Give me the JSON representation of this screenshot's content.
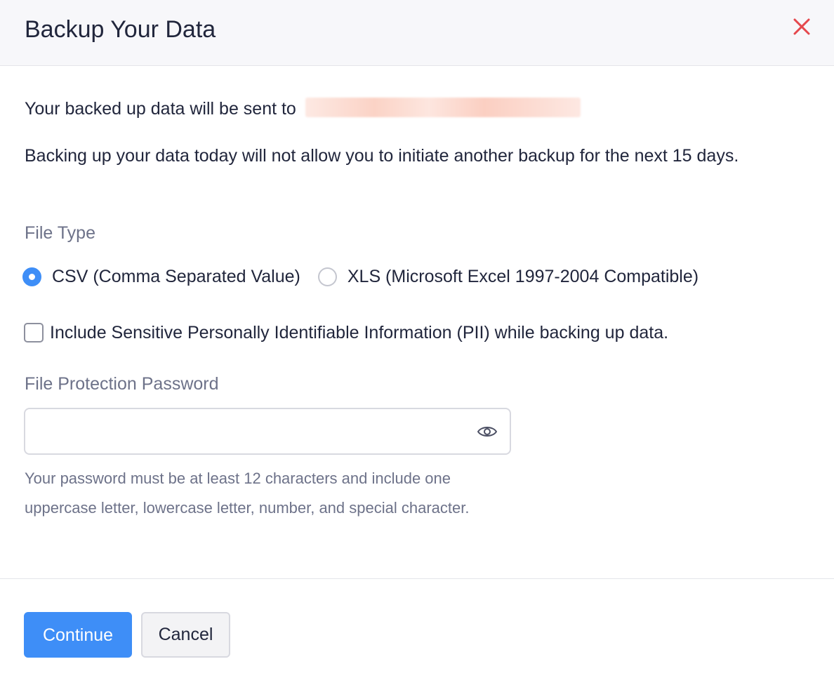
{
  "dialog": {
    "title": "Backup Your Data",
    "close_icon": "close-icon"
  },
  "body": {
    "sent_to_text": "Your backed up data will be sent to",
    "warning_text": "Backing up your data today will not allow you to initiate another backup for the next 15 days.",
    "file_type_label": "File Type",
    "file_types": [
      {
        "label": "CSV (Comma Separated Value)",
        "selected": true
      },
      {
        "label": "XLS (Microsoft Excel 1997-2004 Compatible)",
        "selected": false
      }
    ],
    "pii_checkbox_label": "Include Sensitive Personally Identifiable Information (PII) while backing up data.",
    "pii_checked": false,
    "password_label": "File Protection Password",
    "password_value": "",
    "password_placeholder": "",
    "password_hint": "Your password must be at least 12 characters and include one uppercase letter, lowercase letter, number, and special character.",
    "eye_icon": "eye-icon"
  },
  "footer": {
    "continue_label": "Continue",
    "cancel_label": "Cancel"
  },
  "colors": {
    "accent": "#3e8ef7",
    "close": "#e5484d",
    "muted_text": "#6d7289",
    "header_bg": "#f7f7fa"
  }
}
